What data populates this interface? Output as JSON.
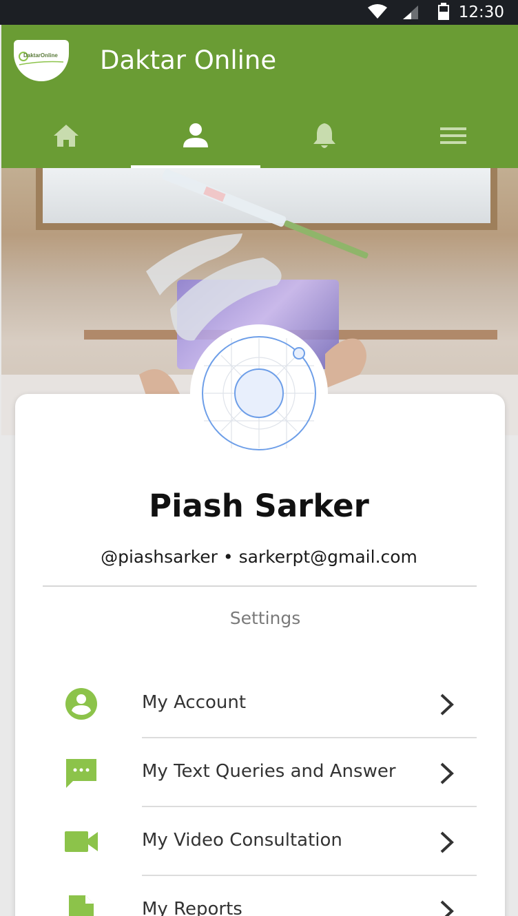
{
  "status_bar": {
    "time": "12:30",
    "icons": [
      "wifi-icon",
      "signal-icon",
      "battery-icon"
    ]
  },
  "app": {
    "title": "Daktar Online",
    "logo_text": "DaktarOnline",
    "brand_color": "#6a9c34",
    "accent_color": "#8cc34a"
  },
  "nav": {
    "tabs": [
      {
        "name": "home",
        "icon": "home-icon",
        "active": false
      },
      {
        "name": "profile",
        "icon": "person-icon",
        "active": true
      },
      {
        "name": "notifications",
        "icon": "bell-icon",
        "active": false
      },
      {
        "name": "menu",
        "icon": "hamburger-icon",
        "active": false
      }
    ]
  },
  "profile": {
    "name": "Piash Sarker",
    "username_email": "@piashsarker • sarkerpt@gmail.com"
  },
  "settings": {
    "heading": "Settings",
    "items": [
      {
        "label": "My Account",
        "icon": "account-circle-icon"
      },
      {
        "label": "My Text Queries and Answer",
        "icon": "chat-icon"
      },
      {
        "label": "My Video Consultation",
        "icon": "video-camera-icon"
      },
      {
        "label": "My Reports",
        "icon": "document-icon"
      }
    ]
  }
}
